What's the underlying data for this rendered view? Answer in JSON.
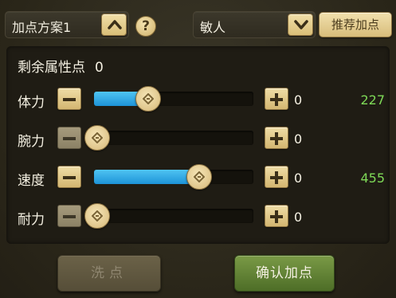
{
  "top_bar": {
    "plan_selector": {
      "label": "加点方案1",
      "icon": "chevron-up-icon"
    },
    "help": {
      "glyph": "?",
      "icon": "question-mark-icon"
    },
    "class_selector": {
      "label": "敏人",
      "icon": "chevron-down-icon"
    },
    "recommend_label": "推荐加点"
  },
  "remaining": {
    "label": "剩余属性点",
    "value": "0"
  },
  "stats": [
    {
      "label": "体力",
      "allocated": "0",
      "value": "227",
      "level": 0.34
    },
    {
      "label": "腕力",
      "allocated": "0",
      "value": "",
      "level": 0.0
    },
    {
      "label": "速度",
      "allocated": "0",
      "value": "455",
      "level": 0.66
    },
    {
      "label": "耐力",
      "allocated": "0",
      "value": "",
      "level": 0.0
    }
  ],
  "buttons": {
    "wash_label": "洗点",
    "confirm_label": "确认加点"
  },
  "colors": {
    "fill": "#1d93d8",
    "value_green": "#7ed957",
    "confirm_green": "#5e7f33",
    "gold": "#d9be78"
  }
}
